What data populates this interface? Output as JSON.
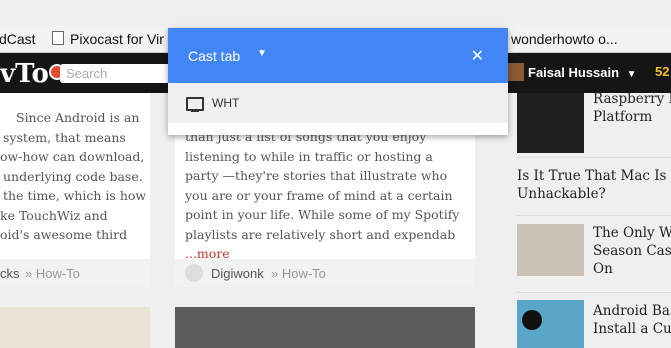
{
  "bookmarks": [
    {
      "label": "dCast"
    },
    {
      "label": "Pixocast for Vir"
    },
    {
      "label": "wonderhowto o..."
    }
  ],
  "site": {
    "logo_text": "vTo",
    "search_placeholder": "Search",
    "user_name": "Faisal Hussain",
    "user_caret": "▼",
    "count": "52"
  },
  "left_card": {
    "lines": [
      "Since Android is an",
      "system, that means",
      "ow-how can download,",
      "underlying code base.",
      "the time, which is how",
      "ke TouchWiz and",
      "oid's awesome third"
    ],
    "author": "cks",
    "category": "» How-To"
  },
  "mid_card": {
    "text": "than just a list of songs that you enjoy listening to while in traffic or hosting a party —they're stories that illustrate who you are or your frame of mind at a certain point in your life. While some of my Spotify playlists are relatively short and expendab",
    "more": "...more",
    "author": "Digiwonk",
    "category": "» How-To"
  },
  "sidebar": {
    "items": [
      {
        "title": "Raspberry Pi\nPlatform"
      },
      {
        "title": "Is It True That Mac Is\nUnhackable?"
      },
      {
        "title": "The Only W\nSeason Cas\nOn"
      },
      {
        "title": "Android Ba\nInstall a Cu"
      }
    ]
  },
  "cast_dialog": {
    "title": "Cast tab",
    "caret": "▼",
    "close": "✕",
    "device": "WHT"
  }
}
